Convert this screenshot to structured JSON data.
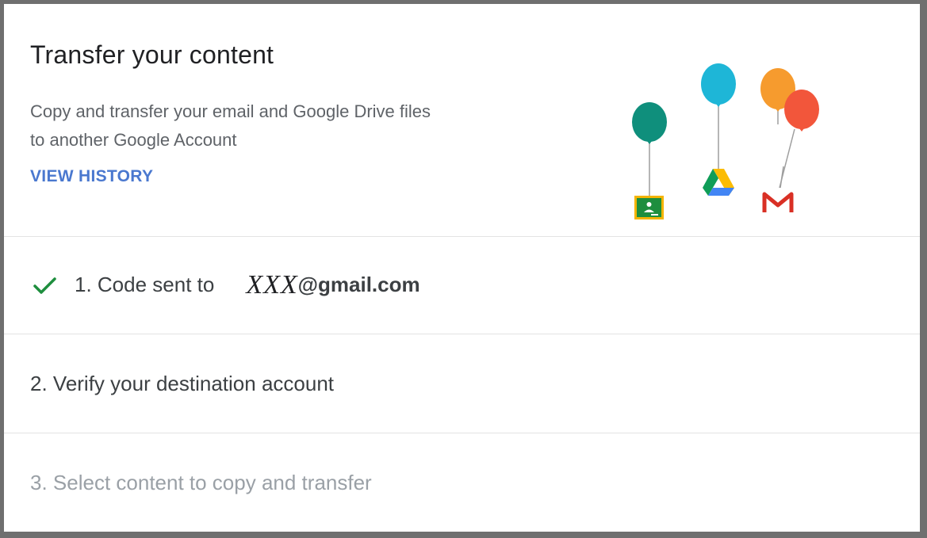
{
  "header": {
    "title": "Transfer your content",
    "description_line1": "Copy and transfer your email and Google Drive files",
    "description_line2": "to another Google Account",
    "view_history_label": "VIEW HISTORY"
  },
  "illustration": {
    "icons": [
      "classroom-icon",
      "drive-icon",
      "gmail-icon"
    ],
    "balloon_colors": [
      "#0f8f7c",
      "#1eb6d7",
      "#f69b2e",
      "#f2563b"
    ]
  },
  "steps": [
    {
      "status": "done",
      "label": "1. Code sent to",
      "email_user": "XXX",
      "email_domain": "@gmail.com"
    },
    {
      "status": "active",
      "label": "2. Verify your destination account"
    },
    {
      "status": "pending",
      "label": "3. Select content to copy and transfer"
    }
  ],
  "colors": {
    "link": "#4a78cf",
    "check": "#1e8e3e",
    "divider": "#e3e3e3"
  }
}
